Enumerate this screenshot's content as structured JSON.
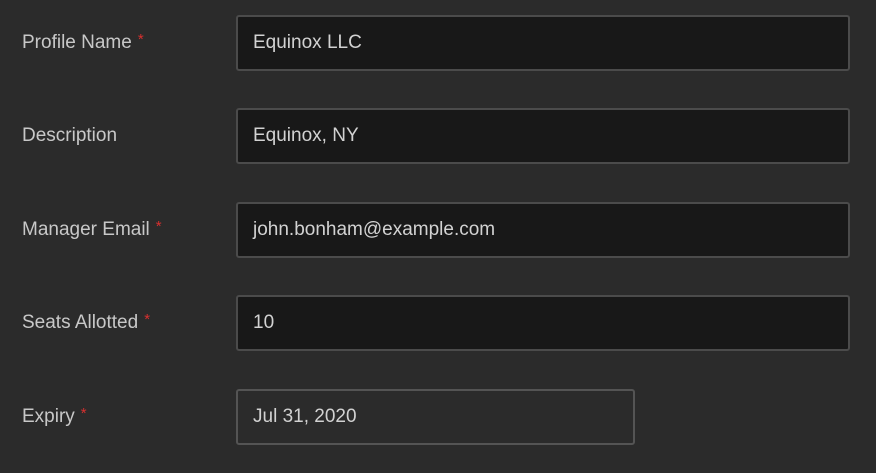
{
  "form": {
    "fields": [
      {
        "label": "Profile Name",
        "required_mark": "*",
        "value": "Equinox LLC"
      },
      {
        "label": "Description",
        "required_mark": "",
        "value": "Equinox, NY"
      },
      {
        "label": "Manager Email",
        "required_mark": "*",
        "value": "john.bonham@example.com"
      },
      {
        "label": "Seats Allotted",
        "required_mark": "*",
        "value": "10"
      },
      {
        "label": "Expiry",
        "required_mark": "*",
        "value": "Jul 31, 2020"
      }
    ]
  },
  "colors": {
    "background": "#2b2b2b",
    "input_background": "#181818",
    "input_border": "#4b4b4b",
    "required_mark": "#d8302f",
    "text": "#c8c8c8"
  }
}
